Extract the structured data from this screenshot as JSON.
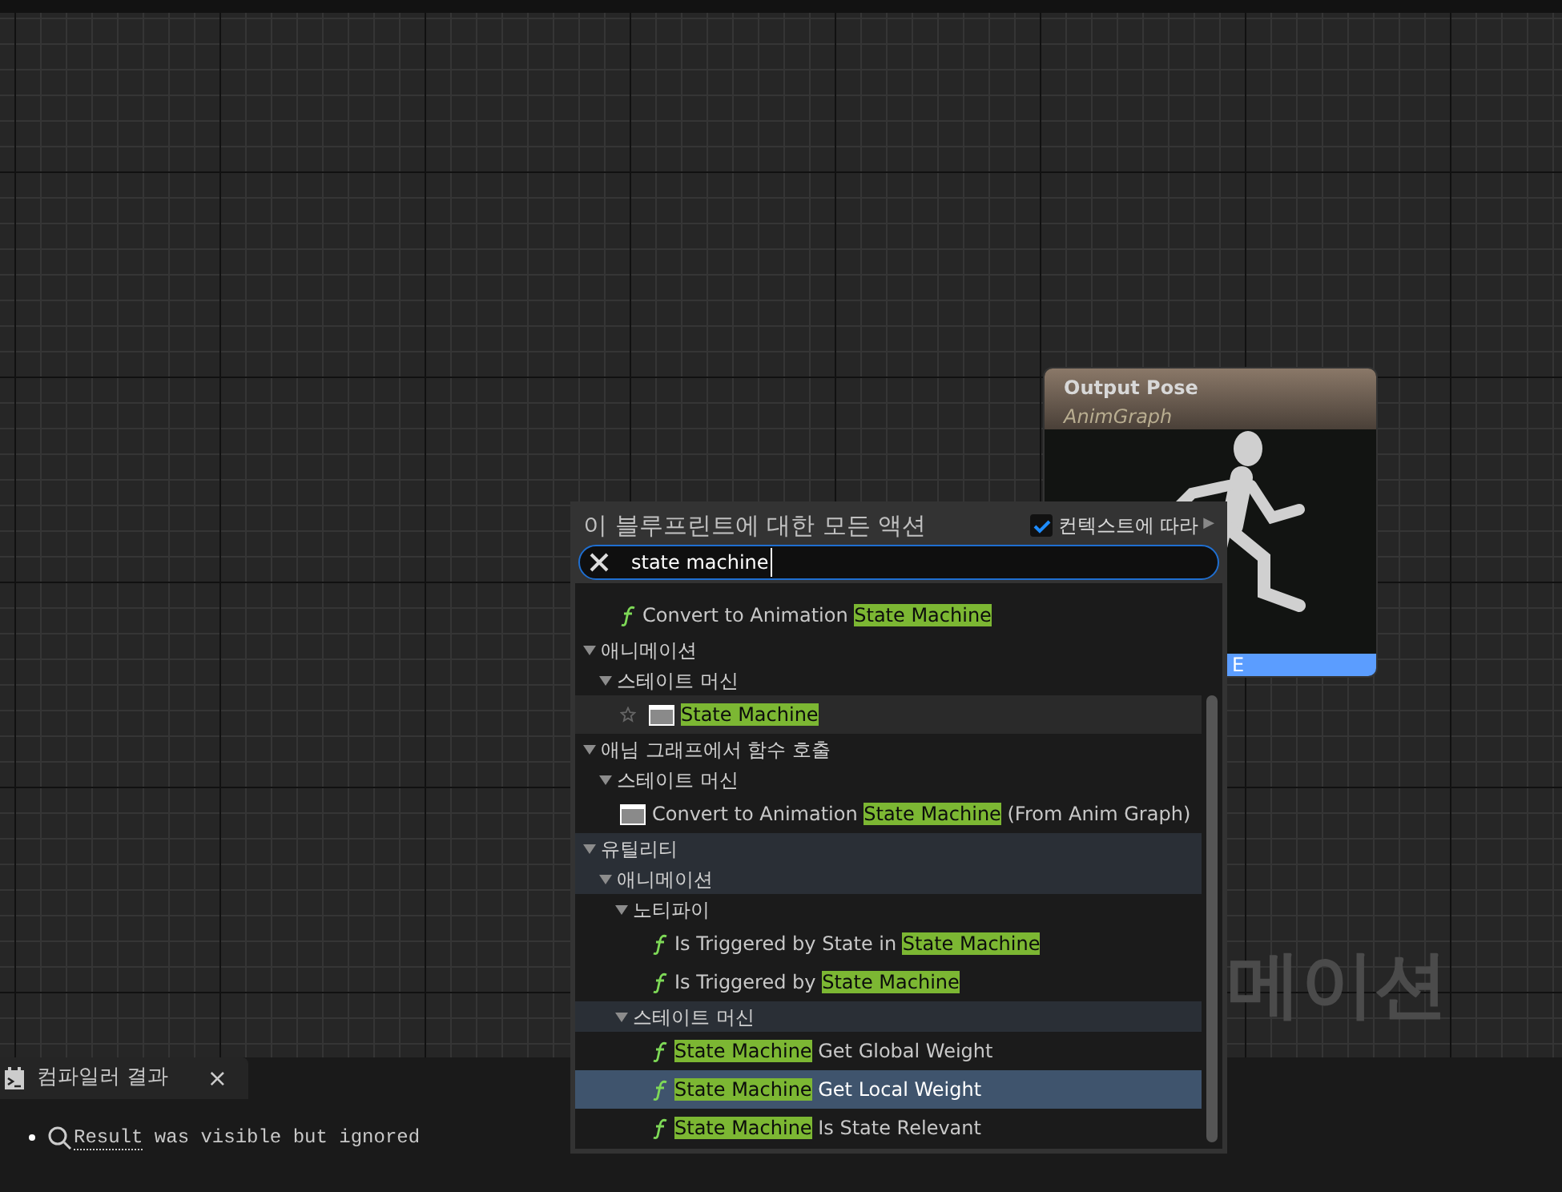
{
  "graph": {
    "watermark": "메이션"
  },
  "node": {
    "title": "Output Pose",
    "subtitle": "AnimGraph",
    "pin_label": "E"
  },
  "action_menu": {
    "title": "이 블루프린트에 대한 모든 액션",
    "context_toggle": {
      "label": "컨텍스트에 따라",
      "checked": true,
      "arrow": "▶"
    },
    "search": {
      "value": "state machine"
    },
    "leading_items": [
      {
        "kind": "function",
        "hovered": false,
        "selected": false,
        "parts": [
          {
            "text": "Convert to Animation ",
            "match": false
          },
          {
            "text": "State Machine",
            "match": true
          }
        ]
      }
    ],
    "tree": [
      {
        "kind": "category",
        "label": "애니메이션",
        "expanded": true,
        "highlighted": false,
        "children": [
          {
            "kind": "category",
            "label": "스테이트 머신",
            "expanded": true,
            "highlighted": false,
            "children": [
              {
                "kind": "node",
                "hovered": true,
                "selected": false,
                "parts": [
                  {
                    "text": "State Machine",
                    "match": true
                  }
                ]
              }
            ]
          }
        ]
      },
      {
        "kind": "category",
        "label": "애님 그래프에서 함수 호출",
        "expanded": true,
        "highlighted": false,
        "children": [
          {
            "kind": "category",
            "label": "스테이트 머신",
            "expanded": true,
            "highlighted": false,
            "children": [
              {
                "kind": "node",
                "hovered": false,
                "selected": false,
                "parts": [
                  {
                    "text": "Convert to Animation ",
                    "match": false
                  },
                  {
                    "text": "State Machine",
                    "match": true
                  },
                  {
                    "text": " (From Anim Graph)",
                    "match": false
                  }
                ]
              }
            ]
          }
        ]
      },
      {
        "kind": "category",
        "label": "유틸리티",
        "expanded": true,
        "highlighted": true,
        "children": [
          {
            "kind": "category",
            "label": "애니메이션",
            "expanded": true,
            "highlighted": true,
            "children": [
              {
                "kind": "category",
                "label": "노티파이",
                "expanded": true,
                "highlighted": false,
                "children": [
                  {
                    "kind": "function",
                    "hovered": false,
                    "selected": false,
                    "parts": [
                      {
                        "text": "Is Triggered by State in ",
                        "match": false
                      },
                      {
                        "text": "State Machine",
                        "match": true
                      }
                    ]
                  },
                  {
                    "kind": "function",
                    "hovered": false,
                    "selected": false,
                    "parts": [
                      {
                        "text": "Is Triggered by ",
                        "match": false
                      },
                      {
                        "text": "State Machine",
                        "match": true
                      }
                    ]
                  }
                ]
              },
              {
                "kind": "category",
                "label": "스테이트 머신",
                "expanded": true,
                "highlighted": true,
                "children": [
                  {
                    "kind": "function",
                    "hovered": false,
                    "selected": false,
                    "parts": [
                      {
                        "text": "State Machine",
                        "match": true
                      },
                      {
                        "text": " Get Global Weight",
                        "match": false
                      }
                    ]
                  },
                  {
                    "kind": "function",
                    "hovered": false,
                    "selected": true,
                    "parts": [
                      {
                        "text": "State Machine",
                        "match": true
                      },
                      {
                        "text": " Get Local Weight",
                        "match": false
                      }
                    ]
                  },
                  {
                    "kind": "function",
                    "hovered": false,
                    "selected": false,
                    "parts": [
                      {
                        "text": "State Machine",
                        "match": true
                      },
                      {
                        "text": " Is State Relevant",
                        "match": false
                      }
                    ]
                  }
                ]
              }
            ]
          }
        ]
      }
    ]
  },
  "compiler_panel": {
    "tab": {
      "label": "컴파일러 결과",
      "close": "×"
    },
    "messages": [
      {
        "link": "Result",
        "text": "was visible but ignored"
      }
    ]
  }
}
